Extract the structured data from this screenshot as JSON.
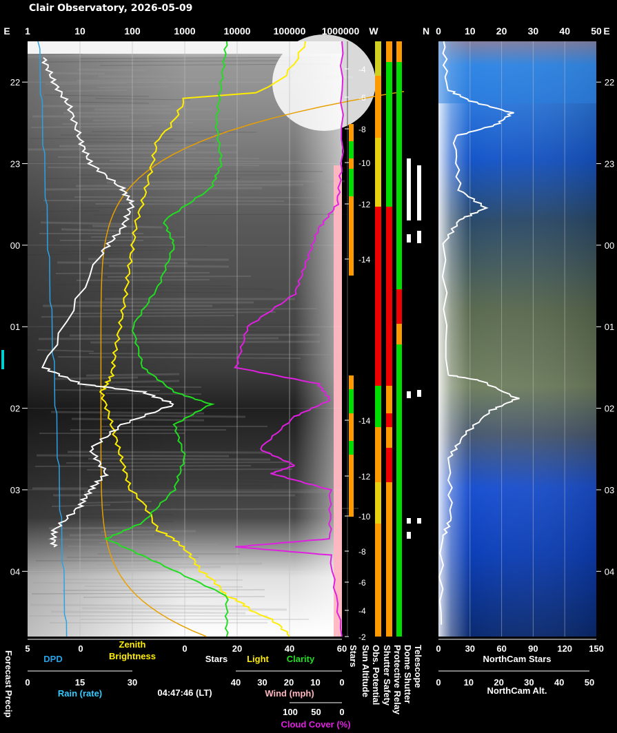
{
  "title": "Clair Observatory, 2026-05-09",
  "timestamp": "04:47:46 (LT)",
  "colors": {
    "dpd": "#29a3e6",
    "zenith": "#ffee00",
    "zenith_model": "#e8a000",
    "stars": "#ffffff",
    "clarity": "#22dd22",
    "cloud": "#e020e0",
    "wind": "#ffb6c1",
    "rain": "#33ccff",
    "ok": "#00dd00",
    "warn": "#ff9900",
    "bad": "#ee0000"
  },
  "top_axis": {
    "left_label": "E",
    "ticks": [
      "1",
      "10",
      "100",
      "1000",
      "10000",
      "100000",
      "1000000"
    ],
    "status_left": "W",
    "status_right": "N",
    "cam_ticks": [
      "0",
      "10",
      "20",
      "30",
      "40",
      "50"
    ],
    "right_label": "E"
  },
  "time_labels": [
    "22",
    "23",
    "00",
    "01",
    "02",
    "03",
    "04"
  ],
  "sun_ticks": [
    "-4",
    "-6",
    "-8",
    "-10",
    "-12",
    "-14",
    "-14",
    "-12",
    "-10",
    "-8",
    "-6",
    "-4",
    "-2"
  ],
  "bottom": {
    "forecast_precip": "Forecast Precip",
    "dpd_ticks": [
      "5",
      "0"
    ],
    "dpd": "DPD",
    "zenith": "Zenith\nBrightness",
    "stars_ticks": [
      "0",
      "20",
      "40",
      "60"
    ],
    "stars": "Stars",
    "light": "Light",
    "clarity": "Clarity",
    "rain_ticks": [
      "0",
      "15",
      "30"
    ],
    "rain": "Rain (rate)",
    "wind_ticks": [
      "40",
      "30",
      "20",
      "10",
      "0"
    ],
    "wind": "Wind (mph)",
    "cloud_ticks": [
      "100",
      "50",
      "0"
    ],
    "cloud": "Cloud Cover (%)",
    "status_labels": [
      "Stars",
      "Sun Altitude",
      "Obs. Potential",
      "Shutter Safety",
      "Protective Relay",
      "Dome Shutter",
      "Telescope"
    ],
    "cam_stars_ticks": [
      "0",
      "30",
      "60",
      "90",
      "120",
      "150"
    ],
    "cam_stars": "NorthCam Stars",
    "cam_alt_ticks": [
      "0",
      "10",
      "20",
      "30",
      "40",
      "50"
    ],
    "cam_alt": "NorthCam Alt."
  },
  "chart_data": {
    "type": "line",
    "title": "Clair Observatory, 2026-05-09",
    "x_time_range": [
      "21:30",
      "04:50"
    ],
    "time_ticks": [
      "22",
      "23",
      "00",
      "01",
      "02",
      "03",
      "04"
    ],
    "main_axis": {
      "scale": "log",
      "range": [
        1,
        1000000
      ]
    },
    "series": [
      {
        "name": "Zenith Brightness",
        "time": [
          21.5,
          22.2,
          22.7,
          23.2,
          23.7,
          0.2,
          0.7,
          1.2,
          1.6,
          1.8,
          2.2,
          2.6,
          3.0,
          3.5,
          3.7,
          4.0,
          4.3,
          4.5,
          4.8
        ],
        "values": [
          200000,
          1000,
          300,
          200,
          120,
          90,
          70,
          50,
          40,
          25,
          40,
          60,
          90,
          300,
          900,
          2000,
          6000,
          20000,
          100000
        ]
      },
      {
        "name": "Stars",
        "time": [
          21.7,
          22.0,
          22.3,
          22.7,
          23.0,
          23.3,
          23.5,
          23.8,
          0.1,
          1.5,
          1.7,
          1.8,
          1.95,
          2.2,
          2.5,
          2.8,
          3.0,
          3.2,
          3.5,
          3.7
        ],
        "values": [
          3,
          5,
          8,
          10,
          12,
          18,
          20,
          18,
          14,
          3,
          10,
          22,
          28,
          18,
          12,
          15,
          12,
          10,
          5,
          5
        ]
      },
      {
        "name": "Clarity",
        "time": [
          21.5,
          22.0,
          22.5,
          23.0,
          23.3,
          23.7,
          0.0,
          0.5,
          1.0,
          1.5,
          1.8,
          1.95,
          2.2,
          2.6,
          3.0,
          3.4,
          3.6,
          3.9,
          4.3,
          4.8
        ],
        "values": [
          38,
          37,
          36,
          37,
          35,
          26,
          28,
          25,
          20,
          22,
          28,
          35,
          28,
          30,
          28,
          22,
          15,
          25,
          38,
          38
        ]
      },
      {
        "name": "Cloud Cover",
        "time": [
          21.5,
          23.0,
          23.5,
          23.8,
          0.2,
          0.6,
          1.0,
          1.5,
          1.7,
          1.9,
          2.1,
          2.5,
          2.7,
          2.8,
          3.0,
          3.6,
          3.7,
          3.8,
          4.8
        ],
        "values": [
          0,
          0,
          2,
          10,
          15,
          20,
          40,
          45,
          10,
          5,
          20,
          35,
          20,
          30,
          5,
          5,
          45,
          5,
          0
        ]
      },
      {
        "name": "Sun Altitude",
        "time": [
          21.6,
          22.0,
          22.5,
          23.0,
          23.5,
          0.0,
          0.5,
          1.0,
          1.5,
          1.9,
          2.3,
          2.8,
          3.3,
          3.7,
          4.0,
          4.4,
          4.8
        ],
        "values": [
          -4,
          -6,
          -8,
          -10,
          -12,
          -14,
          -15,
          -16,
          -17,
          -17,
          -16,
          -14,
          -11,
          -8,
          -6,
          -4,
          -2
        ]
      }
    ],
    "status_strips": [
      {
        "name": "Obs. Potential",
        "segments": [
          [
            "21.5",
            "22.7",
            "warn"
          ],
          [
            "22.7",
            "23.9",
            "warn"
          ],
          [
            "23.9",
            "1.8",
            "bad"
          ],
          [
            "1.8",
            "2.8",
            "warn"
          ],
          [
            "2.8",
            "4.8",
            "warn"
          ]
        ]
      },
      {
        "name": "Shutter Safety",
        "segments": [
          [
            "21.5",
            "23.5",
            "warn"
          ],
          [
            "23.5",
            "2.2",
            "bad"
          ],
          [
            "2.2",
            "4.8",
            "warn"
          ]
        ]
      },
      {
        "name": "Protective Relay",
        "segments": [
          [
            "21.5",
            "4.8",
            "ok"
          ]
        ]
      }
    ],
    "northcam": {
      "stars_range": [
        0,
        150
      ],
      "alt_range": [
        0,
        50
      ]
    }
  }
}
